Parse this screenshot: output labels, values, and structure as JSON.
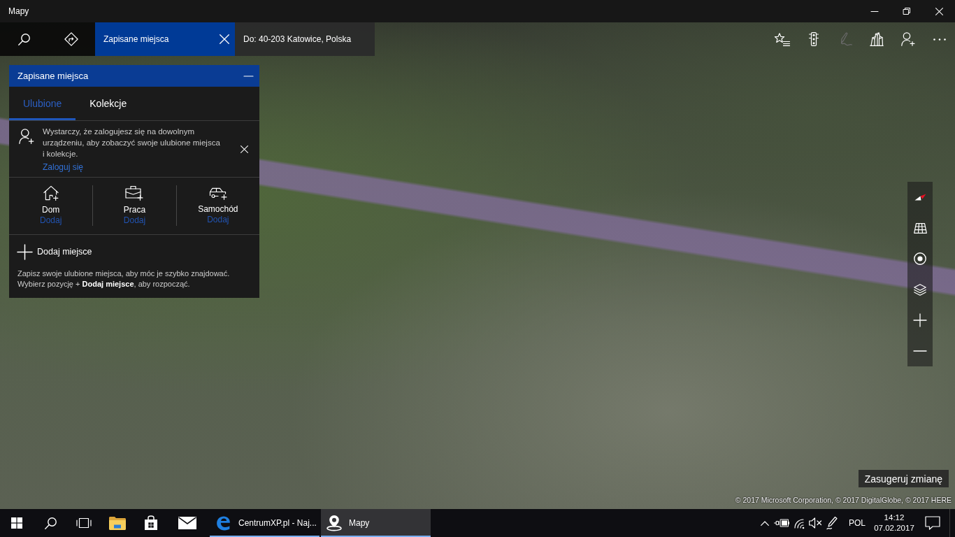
{
  "window": {
    "title": "Mapy"
  },
  "toolbar": {
    "tabs": [
      {
        "label": "Zapisane miejsca",
        "selected": true,
        "closable": true
      },
      {
        "label": "Do: 40-203 Katowice, Polska",
        "selected": false,
        "closable": false
      }
    ],
    "actions": [
      {
        "kind": "favorites",
        "disabled": false
      },
      {
        "kind": "traffic",
        "disabled": false
      },
      {
        "kind": "ink",
        "disabled": true
      },
      {
        "kind": "cities",
        "disabled": false
      },
      {
        "kind": "account",
        "disabled": false
      },
      {
        "kind": "more",
        "disabled": false
      }
    ]
  },
  "saved_places_panel": {
    "title": "Zapisane miejsca",
    "tabs": [
      {
        "label": "Ulubione",
        "selected": true
      },
      {
        "label": "Kolekcje",
        "selected": false
      }
    ],
    "sign_in_notice": {
      "message": "Wystarczy, że zalogujesz się na dowolnym urządzeniu, aby zobaczyć swoje ulubione miejsca i kolekcje.",
      "link": "Zaloguj się"
    },
    "shortcuts": [
      {
        "kind": "home",
        "label": "Dom",
        "action": "Dodaj"
      },
      {
        "kind": "work",
        "label": "Praca",
        "action": "Dodaj"
      },
      {
        "kind": "car",
        "label": "Samochód",
        "action": "Dodaj"
      }
    ],
    "add_place": "Dodaj miejsce",
    "hint": "Zapisz swoje ulubione miejsca, aby móc je szybko znajdować. Wybierz pozycję + **Dodaj miejsce**, aby rozpocząć."
  },
  "map": {
    "suggest_button": "Zasugeruj zmianę",
    "copyright": "© 2017 Microsoft Corporation, © 2017 DigitalGlobe, © 2017 HERE"
  },
  "taskbar": {
    "apps": [
      {
        "kind": "edge",
        "label": "CentrumXP.pl - Naj...",
        "selected": false
      },
      {
        "kind": "maps",
        "label": "Mapy",
        "selected": true
      }
    ],
    "language": "POL",
    "time": "14:12",
    "date": "07.02.2017"
  }
}
